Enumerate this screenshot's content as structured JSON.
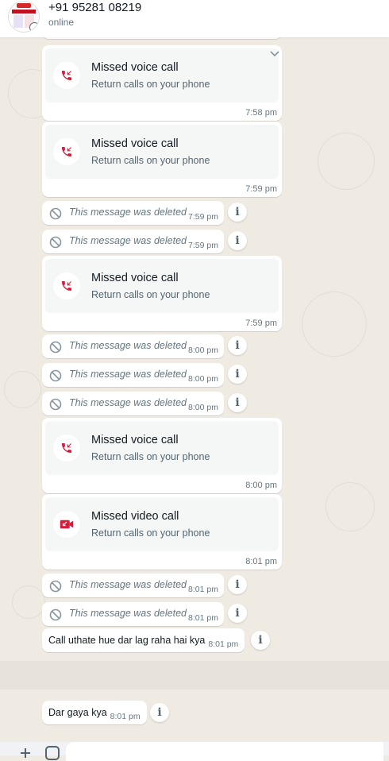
{
  "header": {
    "contact_name": "+91 95281 08219",
    "status": "online"
  },
  "messages": {
    "call_1": {
      "title": "Missed voice call",
      "subtitle": "Return calls on your phone",
      "time": "7:58 pm"
    },
    "call_2": {
      "title": "Missed voice call",
      "subtitle": "Return calls on your phone",
      "time": "7:59 pm"
    },
    "del_1": {
      "text": "This message was deleted",
      "time": "7:59 pm"
    },
    "del_2": {
      "text": "This message was deleted",
      "time": "7:59 pm"
    },
    "call_3": {
      "title": "Missed voice call",
      "subtitle": "Return calls on your phone",
      "time": "7:59 pm"
    },
    "del_3": {
      "text": "This message was deleted",
      "time": "8:00 pm"
    },
    "del_4": {
      "text": "This message was deleted",
      "time": "8:00 pm"
    },
    "del_5": {
      "text": "This message was deleted",
      "time": "8:00 pm"
    },
    "call_4": {
      "title": "Missed voice call",
      "subtitle": "Return calls on your phone",
      "time": "8:00 pm"
    },
    "call_5": {
      "title": "Missed video call",
      "subtitle": "Return calls on your phone",
      "time": "8:01 pm"
    },
    "del_6": {
      "text": "This message was deleted",
      "time": "8:01 pm"
    },
    "del_7": {
      "text": "This message was deleted",
      "time": "8:01 pm"
    },
    "text_1": {
      "text": "Call uthate hue dar lag raha hai kya",
      "time": "8:01 pm"
    },
    "text_2": {
      "text": "Dar gaya kya",
      "time": "8:01 pm"
    }
  },
  "icons": {
    "missed_voice": "missed-voice-call-icon",
    "missed_video": "missed-video-call-icon",
    "deleted": "deleted-ban-icon",
    "info": "info-icon"
  },
  "colors": {
    "missed_call": "#d81b3c",
    "wallpaper": "#efeae2",
    "bubble": "#ffffff",
    "card": "#f5f6f6"
  }
}
